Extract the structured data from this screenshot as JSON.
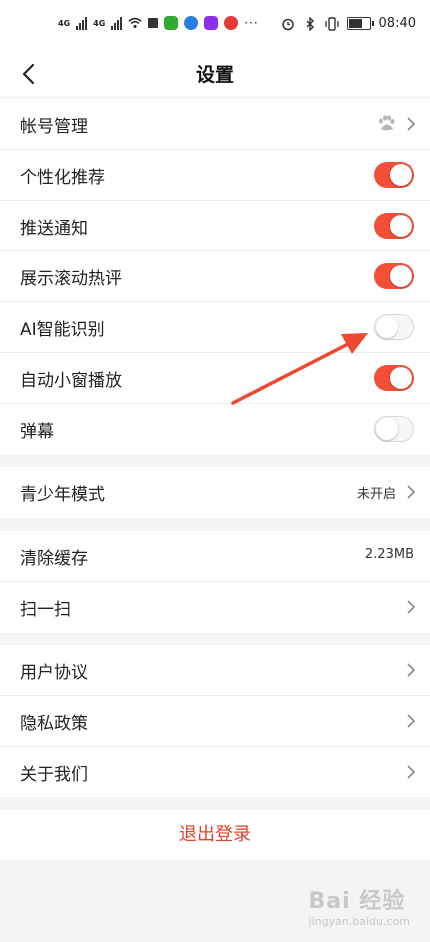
{
  "status_bar": {
    "network_1": "4G",
    "network_2": "4G",
    "time": "08:40"
  },
  "header": {
    "title": "设置"
  },
  "section_1": {
    "items": [
      {
        "label": "帐号管理",
        "type": "link",
        "icon": "paw-icon"
      },
      {
        "label": "个性化推荐",
        "type": "toggle",
        "on": true
      },
      {
        "label": "推送通知",
        "type": "toggle",
        "on": true
      },
      {
        "label": "展示滚动热评",
        "type": "toggle",
        "on": true
      },
      {
        "label": "AI智能识别",
        "type": "toggle",
        "on": false
      },
      {
        "label": "自动小窗播放",
        "type": "toggle",
        "on": true
      },
      {
        "label": "弹幕",
        "type": "toggle",
        "on": false
      }
    ]
  },
  "section_2": {
    "items": [
      {
        "label": "青少年模式",
        "value": "未开启"
      }
    ]
  },
  "section_3": {
    "items": [
      {
        "label": "清除缓存",
        "value": "2.23MB"
      },
      {
        "label": "扫一扫"
      }
    ]
  },
  "section_4": {
    "items": [
      {
        "label": "用户协议"
      },
      {
        "label": "隐私政策"
      },
      {
        "label": "关于我们"
      }
    ]
  },
  "logout_label": "退出登录",
  "watermark": {
    "text": "Bai 经验",
    "sub": "jingyan.baidu.com"
  },
  "colors": {
    "accent": "#f24e38",
    "logout": "#e8402a",
    "annotation": "#f0472f"
  }
}
